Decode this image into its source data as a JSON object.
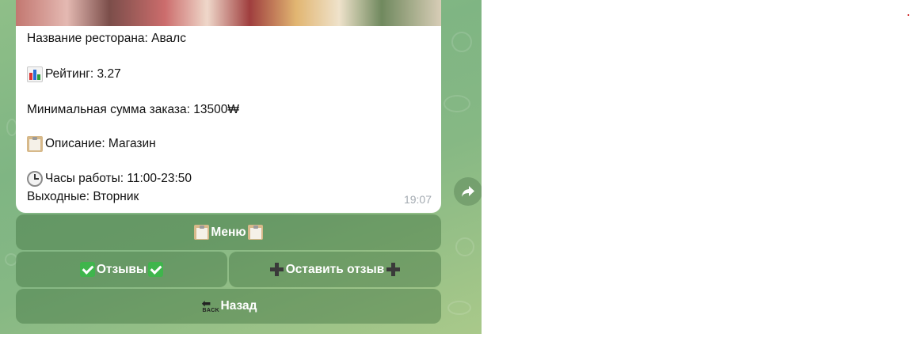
{
  "message": {
    "restaurant_line": "Название ресторана: Авалс",
    "rating_line": "Рейтинг: 3.27",
    "min_order_line": "Минимальная сумма заказа: 13500₩",
    "description_line": "Описание: Магазин",
    "hours_line": "Часы работы: 11:00-23:50",
    "days_off_line": "Выходные: Вторник",
    "time": "19:07"
  },
  "keyboard": {
    "menu_label": "Меню",
    "reviews_label": "Отзывы",
    "leave_review_label": "Оставить отзыв",
    "back_label": "Назад",
    "back_icon_text": "BACK"
  },
  "icons": {
    "rating": "bar-chart-icon",
    "description": "clipboard-icon",
    "hours": "clock-icon",
    "forward": "forward-arrow-icon",
    "reviews": "check-mark-icon",
    "leave_review": "plus-icon",
    "back": "back-arrow-icon"
  },
  "colors": {
    "chat_background": "#86b884",
    "keyboard_button": "#5f8f5c",
    "check_mark": "#3fb54c",
    "timestamp": "#a3aab1"
  }
}
